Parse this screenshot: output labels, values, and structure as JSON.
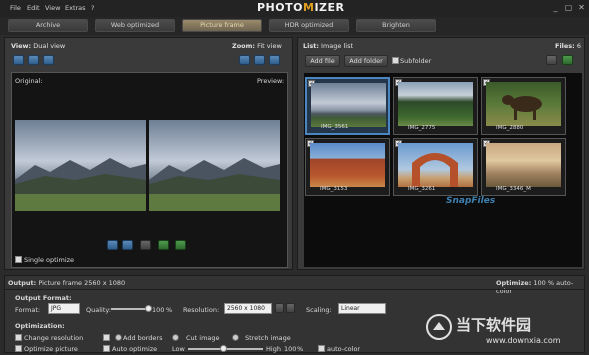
{
  "menu": [
    "File",
    "Edit",
    "View",
    "Extras",
    "?"
  ],
  "logo": {
    "left": "PHOTO",
    "mid": "M",
    "right": "IZER"
  },
  "window_controls": [
    "_",
    "▢",
    "✕"
  ],
  "tabs": [
    {
      "label": "Archive",
      "active": false
    },
    {
      "label": "Web optimized",
      "active": false
    },
    {
      "label": "Picture frame",
      "active": true
    },
    {
      "label": "HDR optimized",
      "active": false
    },
    {
      "label": "Brighten",
      "active": false
    }
  ],
  "left_panel": {
    "view_label": "View:",
    "view_value": "Dual view",
    "zoom_label": "Zoom:",
    "zoom_value": "Fit view",
    "original_label": "Original:",
    "preview_label": "Preview:",
    "single_optimize": "Single optimize"
  },
  "right_panel": {
    "list_label": "List:",
    "list_value": "Image list",
    "files_label": "Files:",
    "files_count": "6",
    "add_file": "Add file",
    "add_folder": "Add folder",
    "subfolder": "Subfolder",
    "thumbs": [
      {
        "caption": "IMG_3561",
        "selected": true,
        "scene": "mountain"
      },
      {
        "caption": "IMG_2775",
        "selected": false,
        "scene": "forest"
      },
      {
        "caption": "IMG_2880",
        "selected": false,
        "scene": "moose"
      },
      {
        "caption": "IMG_3153",
        "selected": false,
        "scene": "redrock"
      },
      {
        "caption": "IMG_3261",
        "selected": false,
        "scene": "arch"
      },
      {
        "caption": "IMG_3346_M",
        "selected": false,
        "scene": "cliff"
      }
    ],
    "snapfiles": "SnapFiles"
  },
  "output_bar": {
    "label": "Output:",
    "value": "Picture frame 2560 x 1080",
    "optimize_label": "Optimize:",
    "optimize_value": "100 % auto-color"
  },
  "output_format": {
    "heading": "Output Format:",
    "format_label": "Format:",
    "format_value": "JPG",
    "quality_label": "Quality:",
    "quality_value": "100",
    "quality_unit": "%",
    "quality_level": 1.0,
    "resolution_label": "Resolution:",
    "resolution_value": "2560 x 1080",
    "scaling_label": "Scaling:",
    "scaling_value": "Linear"
  },
  "optimization": {
    "heading": "Optimization:",
    "change_resolution": "Change resolution",
    "add_borders": "Add borders",
    "cut_image": "Cut image",
    "stretch_image": "Stretch image",
    "optimize_picture": "Optimize picture",
    "auto_optimize": "Auto optimize",
    "low": "Low",
    "high": "High",
    "level_value": "100",
    "level_unit": "%",
    "auto_color": "auto-color"
  },
  "watermark": {
    "cn": "当下软件园",
    "url": "www.downxia.com"
  }
}
